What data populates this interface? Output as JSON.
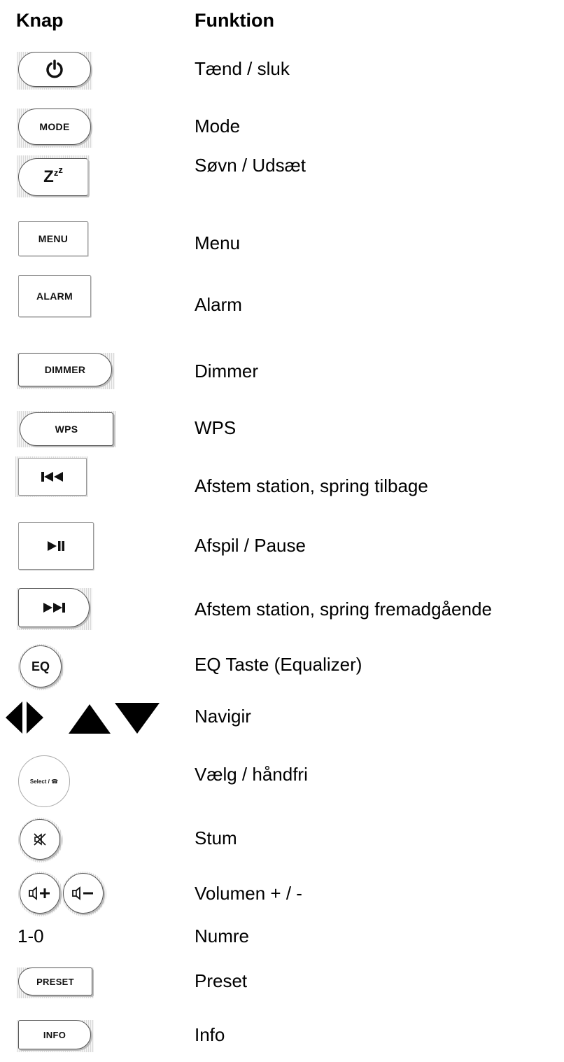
{
  "headers": {
    "button_col": "Knap",
    "function_col": "Funktion"
  },
  "rows": [
    {
      "key": "power",
      "label": "⏻",
      "function": "Tænd / sluk"
    },
    {
      "key": "mode",
      "label": "MODE",
      "function": "Mode"
    },
    {
      "key": "sleep",
      "label": "Z",
      "label_sup": "z",
      "label_sup2": "z",
      "function": "Søvn / Udsæt"
    },
    {
      "key": "menu",
      "label": "MENU",
      "function": "Menu"
    },
    {
      "key": "alarm",
      "label": "ALARM",
      "function": "Alarm"
    },
    {
      "key": "dimmer",
      "label": "DIMMER",
      "function": "Dimmer"
    },
    {
      "key": "wps",
      "label": "WPS",
      "function": "WPS"
    },
    {
      "key": "prev",
      "label": "⏮",
      "function": "Afstem station, spring tilbage"
    },
    {
      "key": "playpause",
      "label": "⏯",
      "function": "Afspil / Pause"
    },
    {
      "key": "next",
      "label": "⏭",
      "function": "Afstem station, spring fremadgående"
    },
    {
      "key": "eq",
      "label": "EQ",
      "function": "EQ Taste (Equalizer)"
    },
    {
      "key": "nav",
      "label": "",
      "function": "Navigir"
    },
    {
      "key": "select",
      "label": "Select / ☎",
      "function": "Vælg / håndfri"
    },
    {
      "key": "mute",
      "label": "",
      "function": "Stum"
    },
    {
      "key": "volume",
      "label": "",
      "function": "Volumen + / -"
    },
    {
      "key": "numbers",
      "label": "1-0",
      "function": "Numre"
    },
    {
      "key": "preset",
      "label": "PRESET",
      "function": "Preset"
    },
    {
      "key": "info",
      "label": "INFO",
      "function": "Info"
    }
  ]
}
